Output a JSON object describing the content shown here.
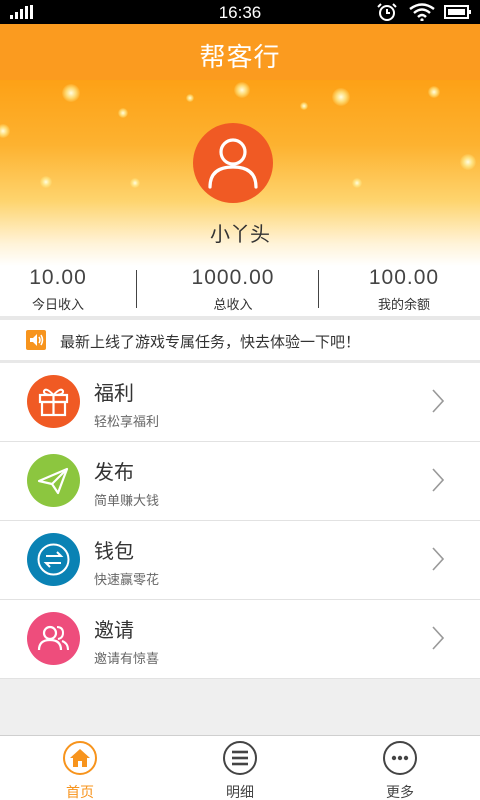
{
  "status_bar": {
    "time": "16:36"
  },
  "header": {
    "title": "帮客行"
  },
  "profile": {
    "name": "小丫头",
    "avatar_icon": "user-icon"
  },
  "stats": [
    {
      "value": "10.00",
      "label": "今日收入"
    },
    {
      "value": "1000.00",
      "label": "总收入"
    },
    {
      "value": "100.00",
      "label": "我的余额"
    }
  ],
  "notice": {
    "icon": "speaker-icon",
    "text": "最新上线了游戏专属任务，快去体验一下吧！"
  },
  "menu": [
    {
      "title": "福利",
      "subtitle": "轻松享福利",
      "icon": "gift-icon",
      "color": "#f05a24"
    },
    {
      "title": "发布",
      "subtitle": "简单赚大钱",
      "icon": "paper-plane-icon",
      "color": "#8cc63f"
    },
    {
      "title": "钱包",
      "subtitle": "快速赢零花",
      "icon": "exchange-icon",
      "color": "#0a82b4"
    },
    {
      "title": "邀请",
      "subtitle": "邀请有惊喜",
      "icon": "users-icon",
      "color": "#ee4d7c"
    }
  ],
  "tabs": [
    {
      "label": "首页",
      "icon": "home-icon",
      "active": true
    },
    {
      "label": "明细",
      "icon": "list-icon",
      "active": false
    },
    {
      "label": "更多",
      "icon": "more-icon",
      "active": false
    }
  ],
  "colors": {
    "accent": "#f7941d",
    "header": "#fb9b1f",
    "icon_gray": "#444444"
  }
}
